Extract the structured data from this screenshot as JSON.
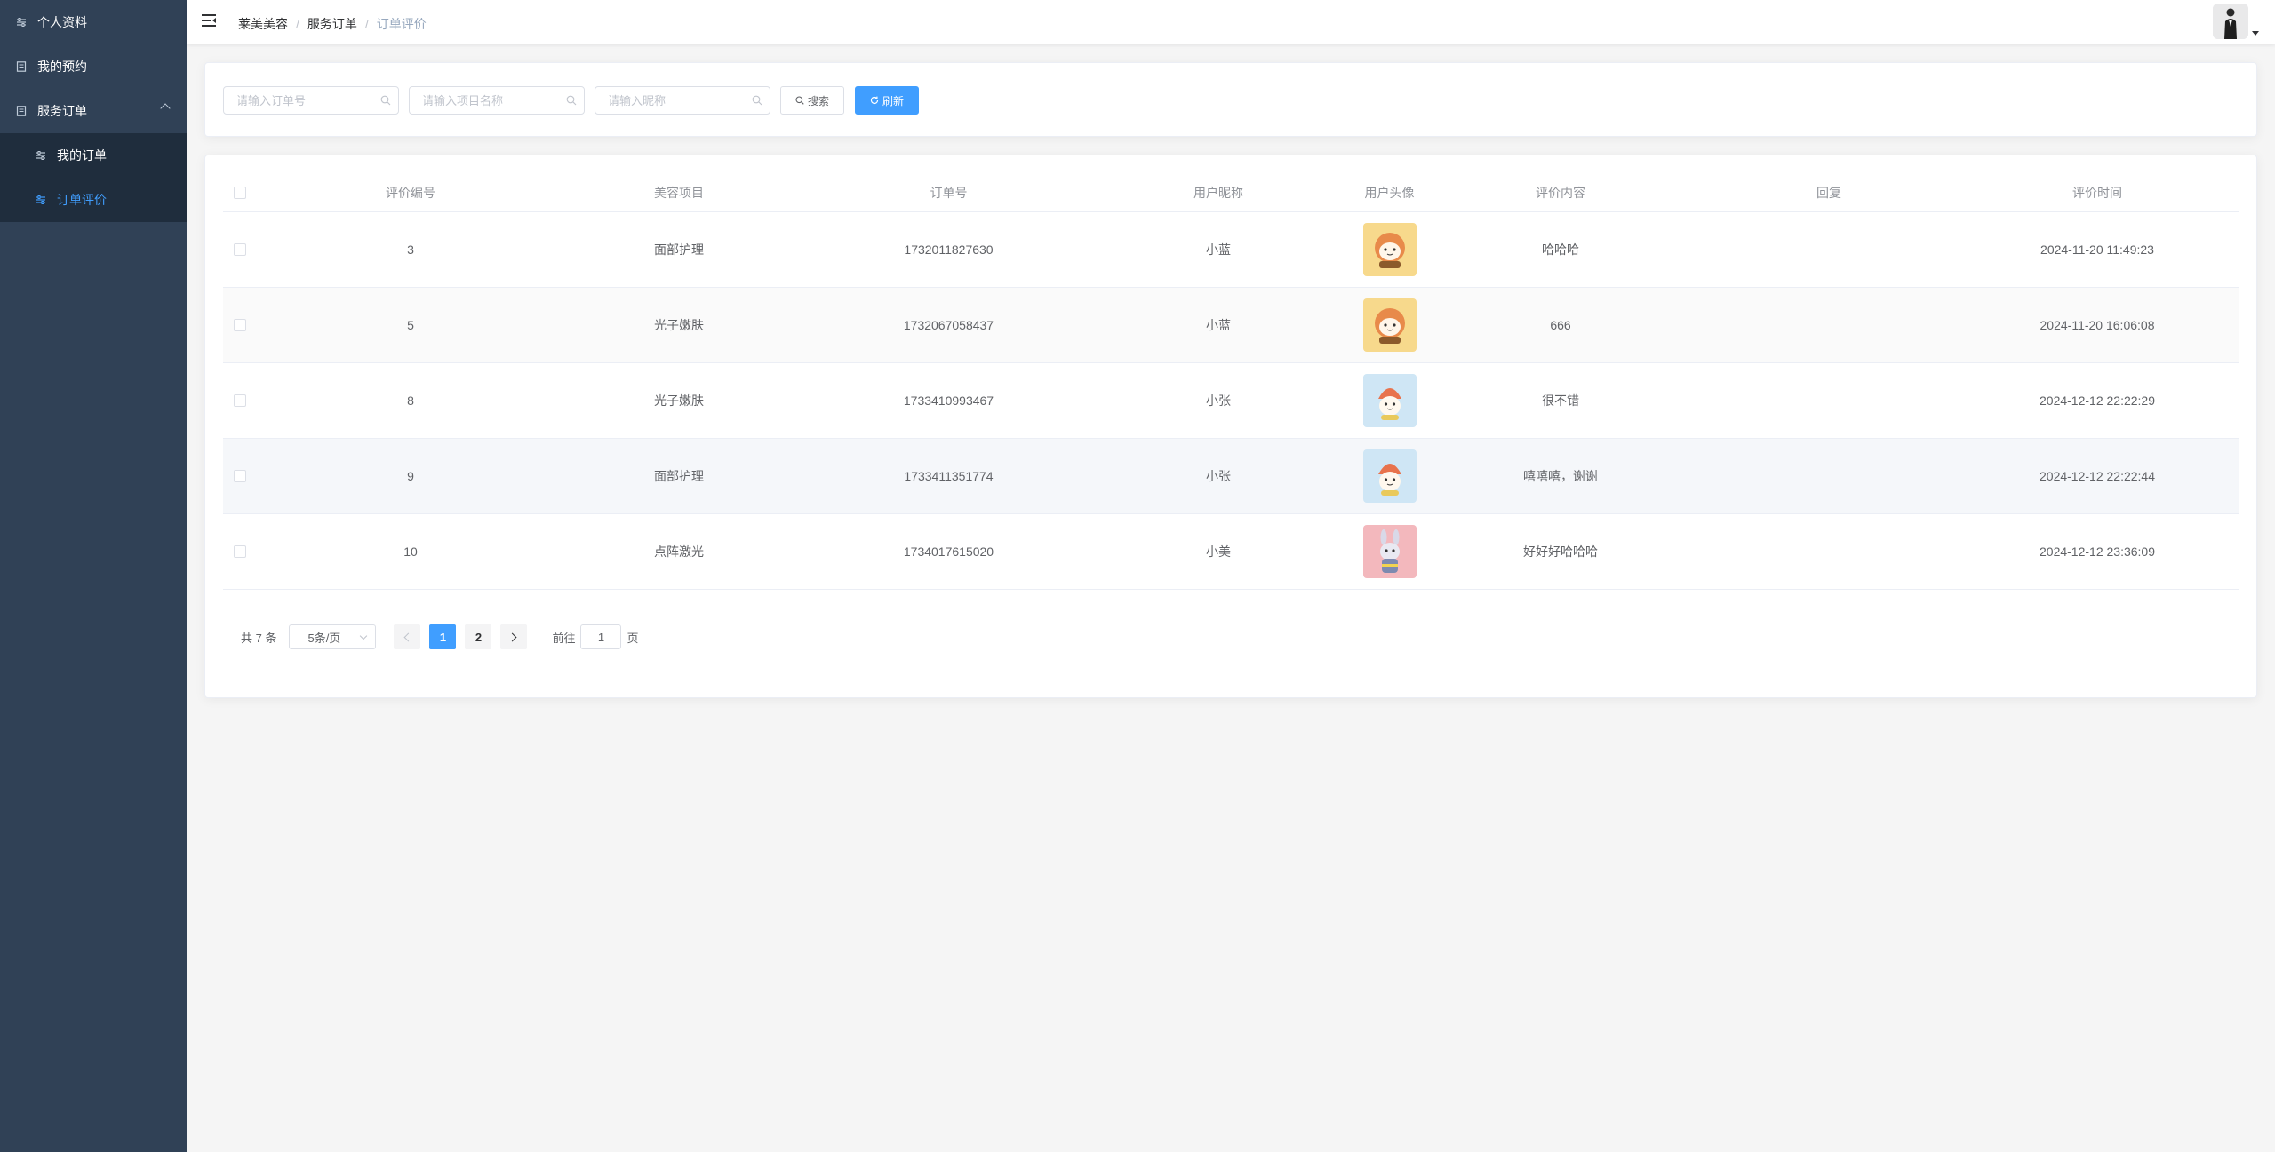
{
  "sidebar": {
    "items": [
      {
        "label": "个人资料",
        "icon": "sliders-icon"
      },
      {
        "label": "我的预约",
        "icon": "document-icon"
      },
      {
        "label": "服务订单",
        "icon": "document-icon",
        "expanded": true,
        "children": [
          {
            "label": "我的订单",
            "icon": "sliders-icon"
          },
          {
            "label": "订单评价",
            "icon": "sliders-icon",
            "active": true
          }
        ]
      }
    ]
  },
  "breadcrumb": [
    "莱美美容",
    "服务订单",
    "订单评价"
  ],
  "search": {
    "order_no_placeholder": "请输入订单号",
    "project_placeholder": "请输入项目名称",
    "nickname_placeholder": "请输入昵称",
    "search_label": "搜索",
    "refresh_label": "刷新"
  },
  "table": {
    "headers": [
      "评价编号",
      "美容项目",
      "订单号",
      "用户昵称",
      "用户头像",
      "评价内容",
      "回复",
      "评价时间"
    ],
    "rows": [
      {
        "id": "3",
        "item": "面部护理",
        "order": "1732011827630",
        "nick": "小蓝",
        "avatar": "yellow",
        "content": "哈哈哈",
        "reply": "",
        "time": "2024-11-20 11:49:23"
      },
      {
        "id": "5",
        "item": "光子嫩肤",
        "order": "1732067058437",
        "nick": "小蓝",
        "avatar": "yellow",
        "content": "666",
        "reply": "",
        "time": "2024-11-20 16:06:08"
      },
      {
        "id": "8",
        "item": "光子嫩肤",
        "order": "1733410993467",
        "nick": "小张",
        "avatar": "blue",
        "content": "很不错",
        "reply": "",
        "time": "2024-12-12 22:22:29"
      },
      {
        "id": "9",
        "item": "面部护理",
        "order": "1733411351774",
        "nick": "小张",
        "avatar": "blue",
        "content": "嘻嘻嘻，谢谢",
        "reply": "",
        "time": "2024-12-12 22:22:44"
      },
      {
        "id": "10",
        "item": "点阵激光",
        "order": "1734017615020",
        "nick": "小美",
        "avatar": "pink",
        "content": "好好好哈哈哈",
        "reply": "",
        "time": "2024-12-12 23:36:09"
      }
    ]
  },
  "pagination": {
    "total_label": "共 7 条",
    "page_size_label": "5条/页",
    "pages": [
      "1",
      "2"
    ],
    "current_page": "1",
    "jump_prefix": "前往",
    "jump_value": "1",
    "jump_suffix": "页"
  },
  "colors": {
    "sidebar_bg": "#304156",
    "submenu_bg": "#1f2d3d",
    "accent": "#409eff"
  }
}
